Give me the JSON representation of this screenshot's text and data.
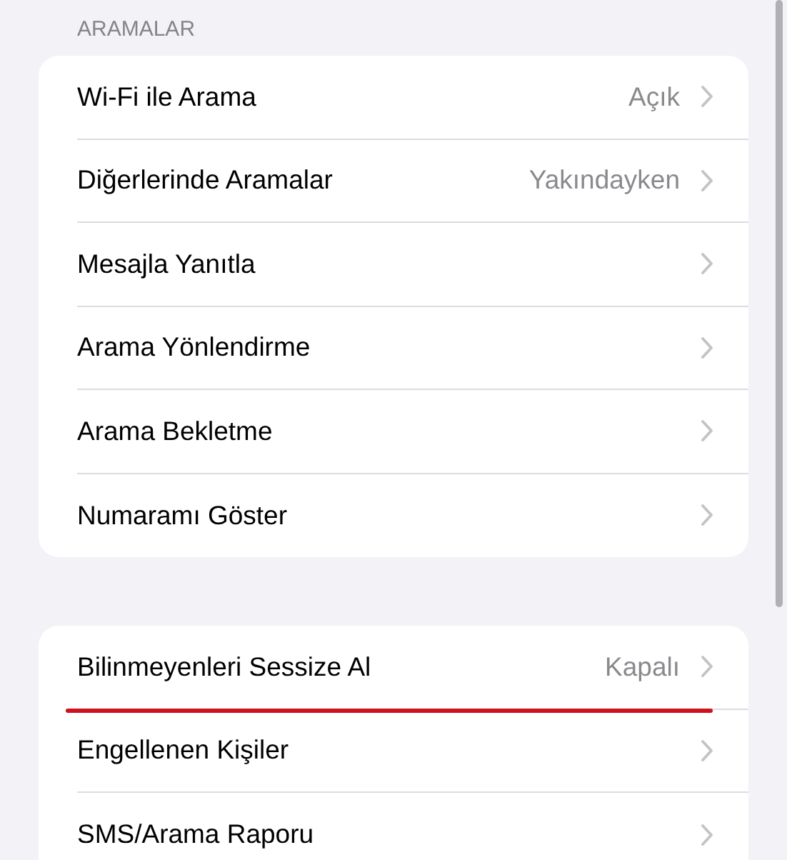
{
  "section_header": "ARAMALAR",
  "groups": [
    {
      "rows": [
        {
          "label": "Wi-Fi ile Arama",
          "value": "Açık",
          "underlined": false
        },
        {
          "label": "Diğerlerinde Aramalar",
          "value": "Yakındayken",
          "underlined": false
        },
        {
          "label": "Mesajla Yanıtla",
          "underlined": false
        },
        {
          "label": "Arama Yönlendirme",
          "underlined": false
        },
        {
          "label": "Arama Bekletme",
          "underlined": false
        },
        {
          "label": "Numaramı Göster",
          "underlined": false
        }
      ]
    },
    {
      "rows": [
        {
          "label": "Bilinmeyenleri Sessize Al",
          "value": "Kapalı",
          "underlined": true
        },
        {
          "label": "Engellenen Kişiler",
          "underlined": false
        },
        {
          "label": "SMS/Arama Raporu",
          "underlined": false
        }
      ]
    }
  ]
}
